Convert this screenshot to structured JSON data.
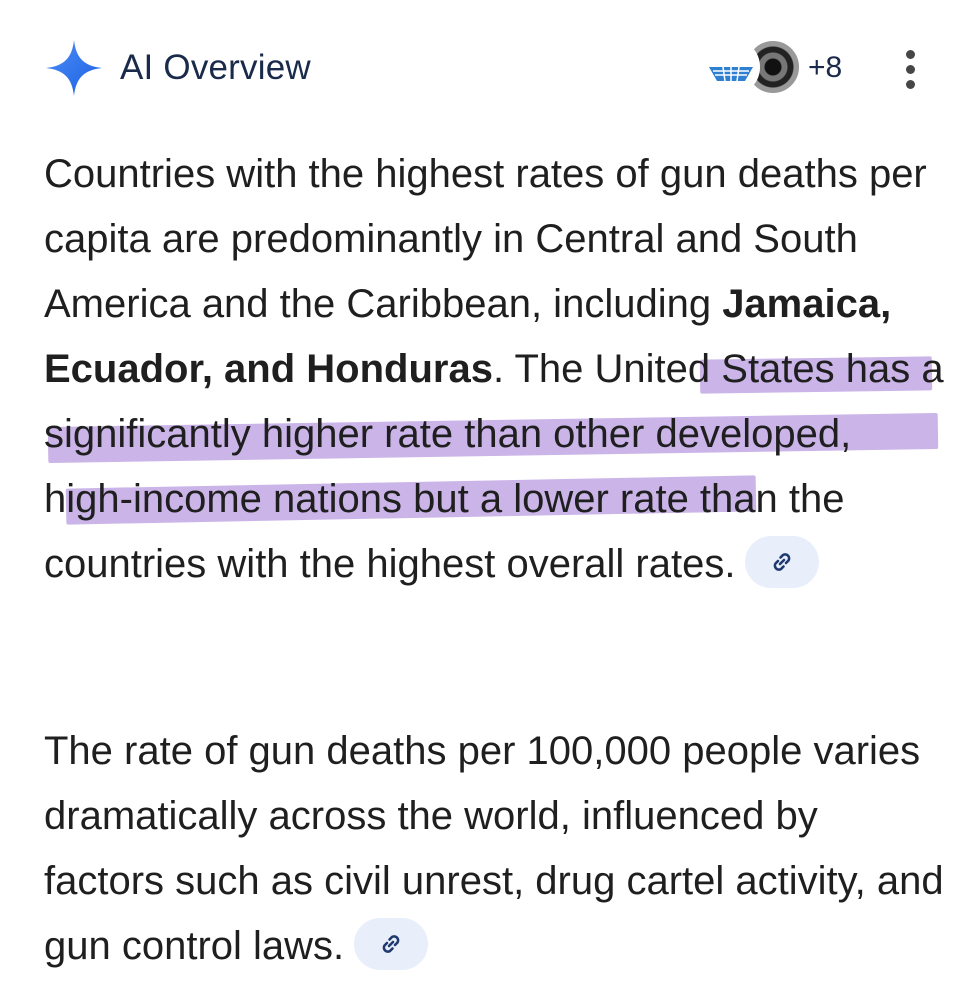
{
  "header": {
    "title": "AI Overview",
    "sources_more_count": "+8",
    "icons": [
      "sparkle-icon",
      "source-avatar-icon",
      "source-avatar-icon",
      "more-vert-icon"
    ]
  },
  "colors": {
    "sparkle": "#4285f4",
    "highlight": "#b89be0",
    "chip": "#e9eefb",
    "text": "#1f1f1f"
  },
  "paragraph1": {
    "text_a": "Countries with the highest rates of gun deaths per capita are predominantly in Central and South America and the Caribbean, including ",
    "bold": "Jamaica, Ecuador, and Honduras",
    "text_b": ". ",
    "highlighted": "The United States has a significantly higher rate than other developed, high-income nations",
    "text_c": " but a lower rate than the countries with the highest overall rates."
  },
  "paragraph2": {
    "text": "The rate of gun deaths per 100,000 people varies dramatically across the world, influenced by factors such as civil unrest, drug cartel activity, and gun control laws."
  }
}
